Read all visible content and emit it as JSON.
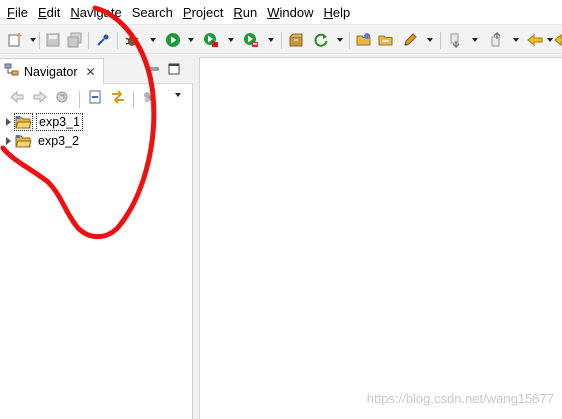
{
  "menubar": {
    "items": [
      {
        "mnemonic": "F",
        "rest": "ile"
      },
      {
        "mnemonic": "E",
        "rest": "dit"
      },
      {
        "mnemonic": "N",
        "rest": "avigate"
      },
      {
        "mnemonic": "",
        "rest": "Search"
      },
      {
        "mnemonic": "P",
        "rest": "roject"
      },
      {
        "mnemonic": "R",
        "rest": "un"
      },
      {
        "mnemonic": "W",
        "rest": "indow"
      },
      {
        "mnemonic": "H",
        "rest": "elp"
      }
    ]
  },
  "toolbar": {
    "icons": [
      "new-icon",
      "save-icon",
      "save-all-icon",
      "pin-icon",
      "debug-icon",
      "run-icon",
      "run-coverage-icon",
      "external-tools-icon",
      "new-package-icon",
      "refresh-icon",
      "open-folder-icon",
      "open-type-icon",
      "pen-icon",
      "next-annotation-icon",
      "prev-annotation-icon",
      "back-icon",
      "forward-icon"
    ]
  },
  "navigator": {
    "tab_label": "Navigator",
    "close_glyph": "✕",
    "items": [
      {
        "label": "exp3_1",
        "selected": true
      },
      {
        "label": "exp3_2",
        "selected": false
      }
    ]
  },
  "watermark": "https://blog.csdn.net/wang15877",
  "colors": {
    "annotation_red": "#ee1111",
    "folder_yellow": "#e8b84a",
    "toolbar_bg": "#f3f3f3"
  }
}
